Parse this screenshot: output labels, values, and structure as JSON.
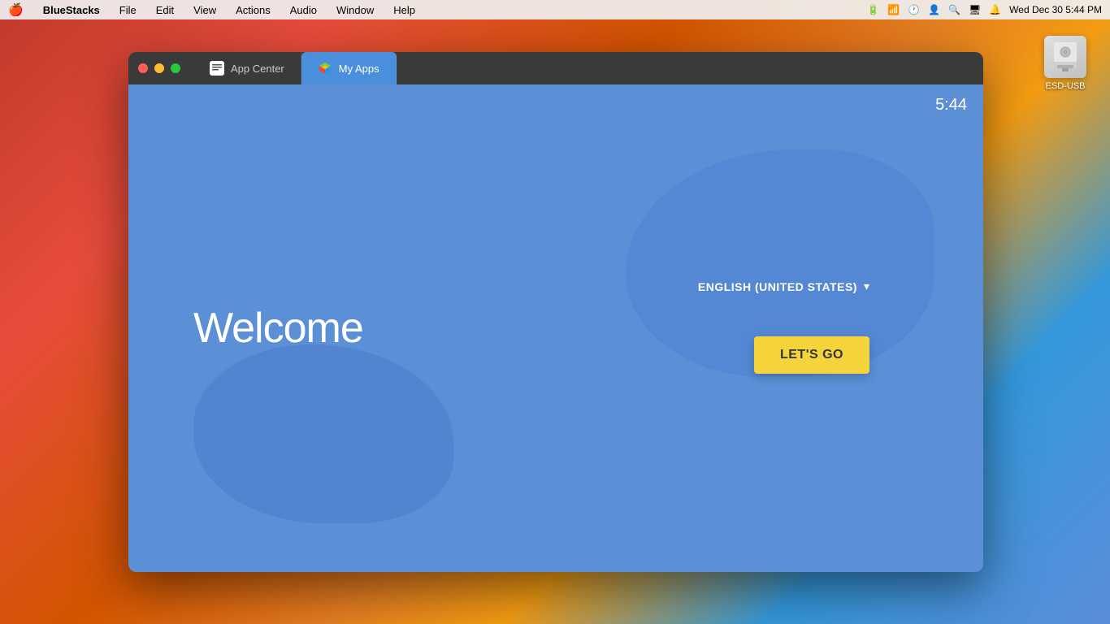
{
  "menubar": {
    "apple": "🍎",
    "app_name": "BlueStacks",
    "menu_items": [
      "File",
      "Edit",
      "View",
      "Actions",
      "Audio",
      "Window",
      "Help"
    ],
    "right_items": {
      "date_time": "Wed Dec 30  5:44 PM",
      "icons": [
        "battery",
        "wifi",
        "clock",
        "user",
        "search",
        "display",
        "notification"
      ]
    }
  },
  "desktop": {
    "esd_usb_label": "ESD-USB"
  },
  "window": {
    "tabs": [
      {
        "id": "app-center",
        "label": "App Center",
        "active": false
      },
      {
        "id": "my-apps",
        "label": "My Apps",
        "active": true
      }
    ],
    "content": {
      "time": "5:44",
      "welcome_text": "Welcome",
      "language": {
        "label": "ENGLISH (UNITED STATES)",
        "arrow": "▾"
      },
      "cta_button": "LET'S GO"
    }
  }
}
